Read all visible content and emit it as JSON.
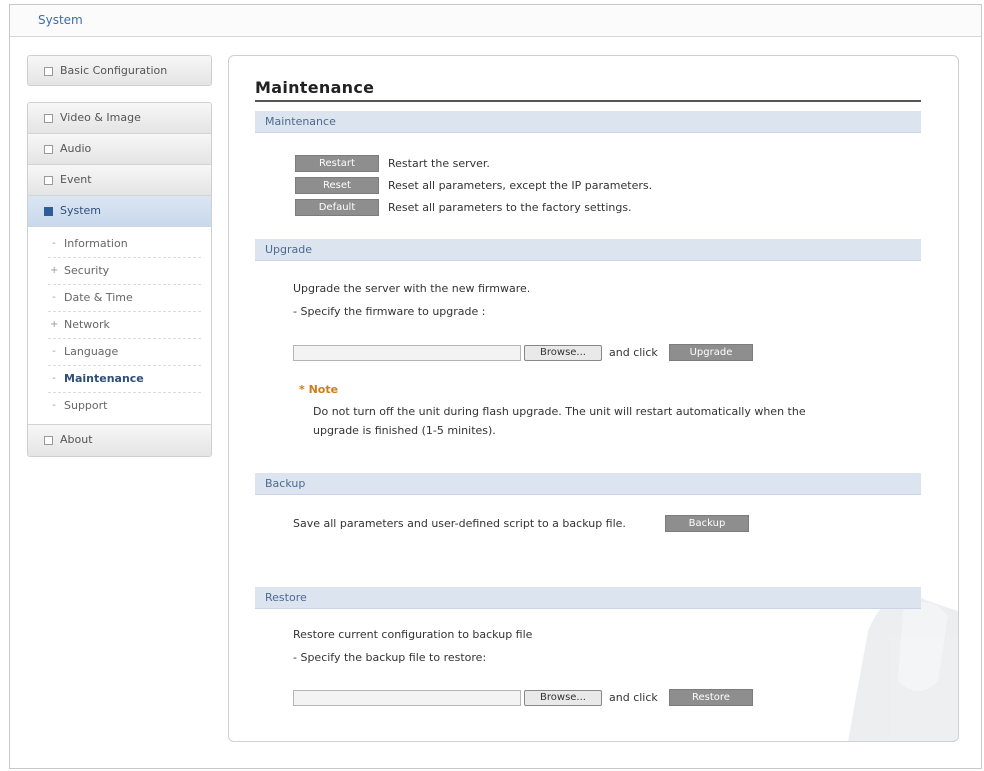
{
  "window": {
    "title": "System"
  },
  "sidebar": {
    "basic": "Basic Configuration",
    "video": "Video & Image",
    "audio": "Audio",
    "event": "Event",
    "system": "System",
    "sub": [
      {
        "label": "Information",
        "mark": "-"
      },
      {
        "label": "Security",
        "mark": "+"
      },
      {
        "label": "Date & Time",
        "mark": "-"
      },
      {
        "label": "Network",
        "mark": "+"
      },
      {
        "label": "Language",
        "mark": "-"
      },
      {
        "label": "Maintenance",
        "mark": "-"
      },
      {
        "label": "Support",
        "mark": "-"
      }
    ],
    "about": "About"
  },
  "main": {
    "title": "Maintenance",
    "maintenance": {
      "header": "Maintenance",
      "restart_label": "Restart",
      "restart_desc": "Restart the server.",
      "reset_label": "Reset",
      "reset_desc": "Reset all parameters, except the IP parameters.",
      "default_label": "Default",
      "default_desc": "Reset all parameters to the factory settings."
    },
    "upgrade": {
      "header": "Upgrade",
      "line1": "Upgrade the server with the new firmware.",
      "line2": "- Specify the firmware to upgrade :",
      "browse_label": "Browse...",
      "and_click": "and click",
      "upgrade_label": "Upgrade",
      "note_title": "* Note",
      "note_line1": "Do not turn off the unit during flash upgrade. The unit will restart automatically when the",
      "note_line2": "upgrade is finished (1-5 minites)."
    },
    "backup": {
      "header": "Backup",
      "desc": "Save all parameters and user-defined script to a backup file.",
      "backup_label": "Backup"
    },
    "restore": {
      "header": "Restore",
      "line1": "Restore current configuration to backup file",
      "line2": "- Specify the backup file to restore:",
      "browse_label": "Browse...",
      "and_click": "and click",
      "restore_label": "Restore"
    }
  }
}
